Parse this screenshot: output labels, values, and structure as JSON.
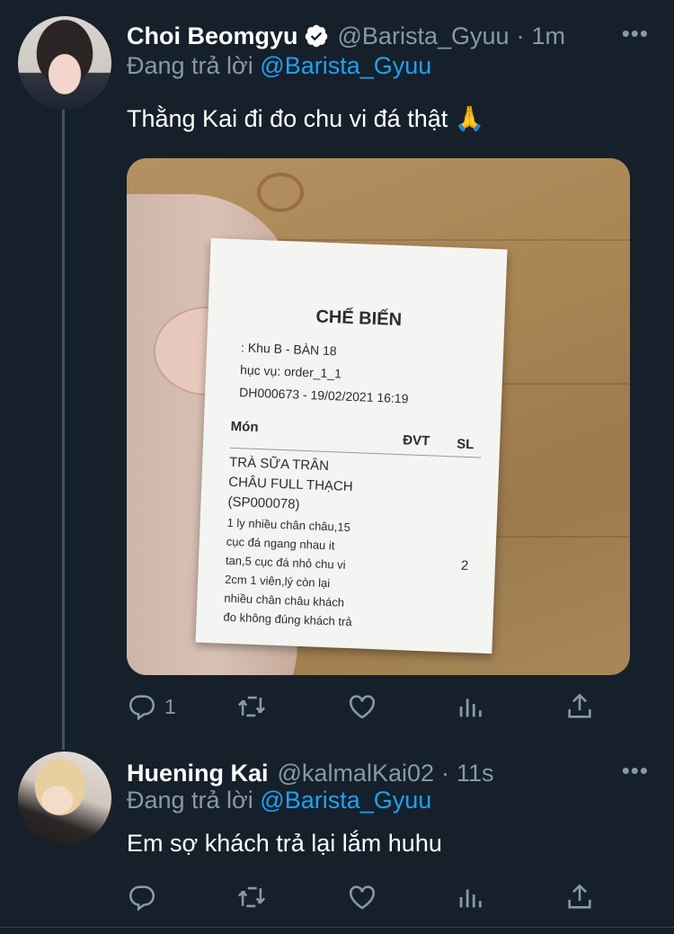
{
  "tweets": [
    {
      "name": "Choi Beomgyu",
      "verified": true,
      "handle": "@Barista_Gyuu",
      "separator": "·",
      "time": "1m",
      "reply_prefix": "Đang trả lời",
      "reply_to": "@Barista_Gyuu",
      "text": "Thằng Kai đi đo chu vi đá thật 🙏",
      "media": {
        "receipt": {
          "title": "CHẾ BIẾN",
          "line1": ": Khu B - BÀN 18",
          "line2": "hục vụ: order_1_1",
          "line3": "DH000673 - 19/02/2021 16:19",
          "col_item": "Món",
          "col_unit": "ĐVT",
          "col_qty": "SL",
          "item_lines": [
            "TRÀ SỮA TRÂN",
            "CHÂU FULL THẠCH",
            "(SP000078)"
          ],
          "note_lines": [
            "1 ly nhiều chân châu,15",
            "cục đá ngang nhau it",
            "tan,5 cục đá nhỏ chu vi",
            "2cm 1 viên,lý còn lại",
            "nhiều chân châu khách",
            "đo không đúng khách trả"
          ],
          "qty": "2"
        }
      },
      "actions": {
        "reply_count": "1"
      }
    },
    {
      "name": "Huening Kai",
      "handle": "@kalmalKai02",
      "separator": "·",
      "time": "11s",
      "reply_prefix": "Đang trả lời",
      "reply_to": "@Barista_Gyuu",
      "text": "Em sợ khách trả lại lắm huhu"
    }
  ],
  "icons": {
    "more": "more-icon",
    "reply": "reply-icon",
    "retweet": "retweet-icon",
    "like": "heart-icon",
    "analytics": "analytics-icon",
    "share": "share-icon",
    "verified": "verified-badge-icon"
  },
  "colors": {
    "background": "#15202b",
    "secondary_text": "#8899a6",
    "link": "#1da1f2",
    "thread_line": "#3d5466"
  }
}
